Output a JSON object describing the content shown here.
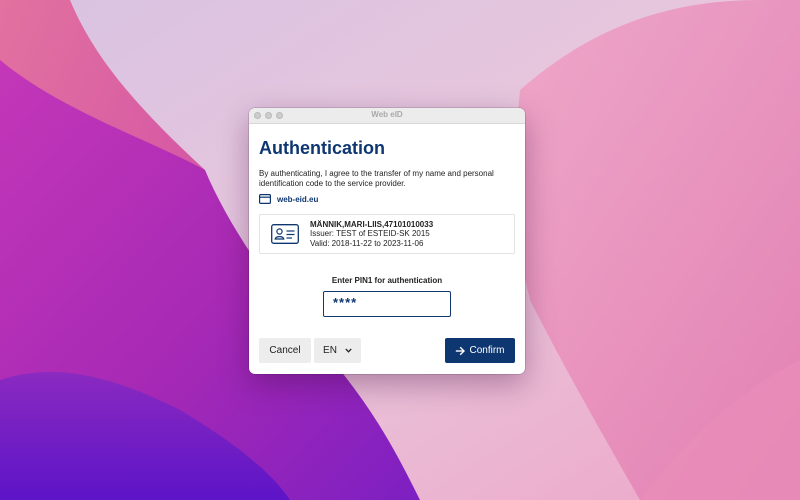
{
  "window": {
    "title": "Web eID"
  },
  "auth": {
    "heading": "Authentication",
    "description": "By authenticating, I agree to the transfer of my name and personal identification code to the service provider.",
    "origin": "web-eid.eu"
  },
  "certificate": {
    "name": "MÄNNIK,MARI-LIIS,47101010033",
    "issuer": "Issuer: TEST of ESTEID-SK 2015",
    "validity": "Valid: 2018-11-22 to 2023-11-06"
  },
  "pin": {
    "label": "Enter PIN1 for authentication",
    "masked_value": "****"
  },
  "buttons": {
    "cancel": "Cancel",
    "language": "EN",
    "confirm": "Confirm"
  },
  "colors": {
    "accent": "#0e3771",
    "button_bg": "#ededed"
  },
  "icons": {
    "origin": "browser-window-icon",
    "certificate": "id-card-icon",
    "language": "chevron-down-icon",
    "confirm": "arrow-right-icon"
  }
}
